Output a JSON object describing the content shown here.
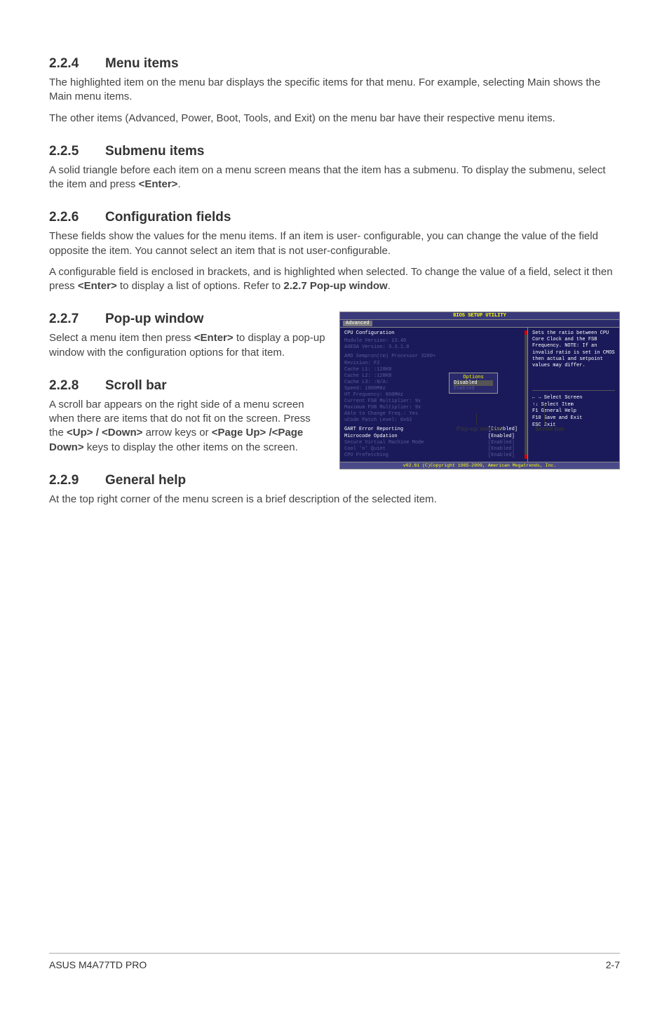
{
  "s224": {
    "heading_num": "2.2.4",
    "heading_title": "Menu items",
    "p1": "The highlighted item on the menu bar displays the specific items for that menu. For example, selecting Main shows the Main menu items.",
    "p2": "The other items (Advanced, Power, Boot, Tools, and Exit) on the menu bar have their respective menu items."
  },
  "s225": {
    "heading_num": "2.2.5",
    "heading_title": "Submenu items",
    "p1a": "A solid triangle before each item on a menu screen means that the item has a submenu. To display the submenu, select the item and press ",
    "p1b": "<Enter>",
    "p1c": "."
  },
  "s226": {
    "heading_num": "2.2.6",
    "heading_title": "Configuration fields",
    "p1": "These fields show the values for the menu items. If an item is user- configurable, you can change the value of the field opposite the item. You cannot select an item that is not user-configurable.",
    "p2a": "A configurable field is enclosed in brackets, and is highlighted when selected. To change the value of a field, select it then press ",
    "p2b": "<Enter>",
    "p2c": " to display a list of options. Refer to ",
    "p2d": "2.2.7 Pop-up window",
    "p2e": "."
  },
  "s227": {
    "heading_num": "2.2.7",
    "heading_title": "Pop-up window",
    "p1a": "Select a menu item then press ",
    "p1b": "<Enter>",
    "p1c": " to display a pop-up window with the configuration options for that item."
  },
  "s228": {
    "heading_num": "2.2.8",
    "heading_title": "Scroll bar",
    "p1a": "A scroll bar appears on the right side of a menu screen when there are items that do not fit on the screen. Press the ",
    "p1b": "<Up> / <Down>",
    "p1c": " arrow keys or ",
    "p1d": "<Page Up> /<Page Down>",
    "p1e": " keys to display the other items on the screen."
  },
  "s229": {
    "heading_num": "2.2.9",
    "heading_title": "General help",
    "p1": "At the top right corner of the menu screen is a brief description of the selected item."
  },
  "bios": {
    "title": "BIOS SETUP UTILITY",
    "tab": "Advanced",
    "section_title": "CPU Configuration",
    "module_version": "Module Version: 13.40",
    "agesa": "AGESA Version: 3.3.1.0",
    "cpu_name": "AMD Sempron(tm) Processor 3200+",
    "revision": "Revision: F2",
    "cache_l1": "Cache L1:  :128KB",
    "cache_l2": "Cache L2:  :128KB",
    "cache_l3": "Cache L3:  :N/A:",
    "speed": "Speed: 1800MHz",
    "ht_freq": "HT Frequency: 800MHz",
    "fsb_mult": "Current FSB Multiplier: 9x",
    "max_fsb": "Maximum FSB Multiplier: 9x",
    "able_change": "Able to Change Freq.: Yes",
    "ucode": "uCode Patch Level: 0x62",
    "rows": [
      {
        "label": "GART Error Reporting",
        "val": "[Disabled]",
        "hl": true
      },
      {
        "label": "Microcode Opdation",
        "val": "[Enabled]",
        "hl": true
      },
      {
        "label": "Secure Virtual Machine Mode",
        "val": "[Enabled]",
        "hl": false
      },
      {
        "label": "Cool 'n' Quiet",
        "val": "[Enabled]",
        "hl": false
      },
      {
        "label": "CPU Prefetching",
        "val": "[Enabled]",
        "hl": false
      }
    ],
    "popup": {
      "title": "Options",
      "opt1": "Disabled",
      "opt2": "Enabled"
    },
    "help": "Sets the ratio between CPU Core Clock and the FSB Frequency.\nNOTE: If an invalid ratio is set in CMOS then actual and setpoint values may differ.",
    "nav": {
      "select_screen": "← →  Select Screen",
      "select_item": "↑↓   Select Item",
      "general_help": "F1   General Help",
      "save_exit": "F10  Save and Exit",
      "exit": "ESC  Exit"
    },
    "footer": "v02.61 (C)Copyright 1985-2009, American Megatrends, Inc."
  },
  "annotations": {
    "popup": "Pop-up window",
    "scroll": "Scroll bar"
  },
  "footer": {
    "left": "ASUS M4A77TD PRO",
    "right": "2-7"
  }
}
